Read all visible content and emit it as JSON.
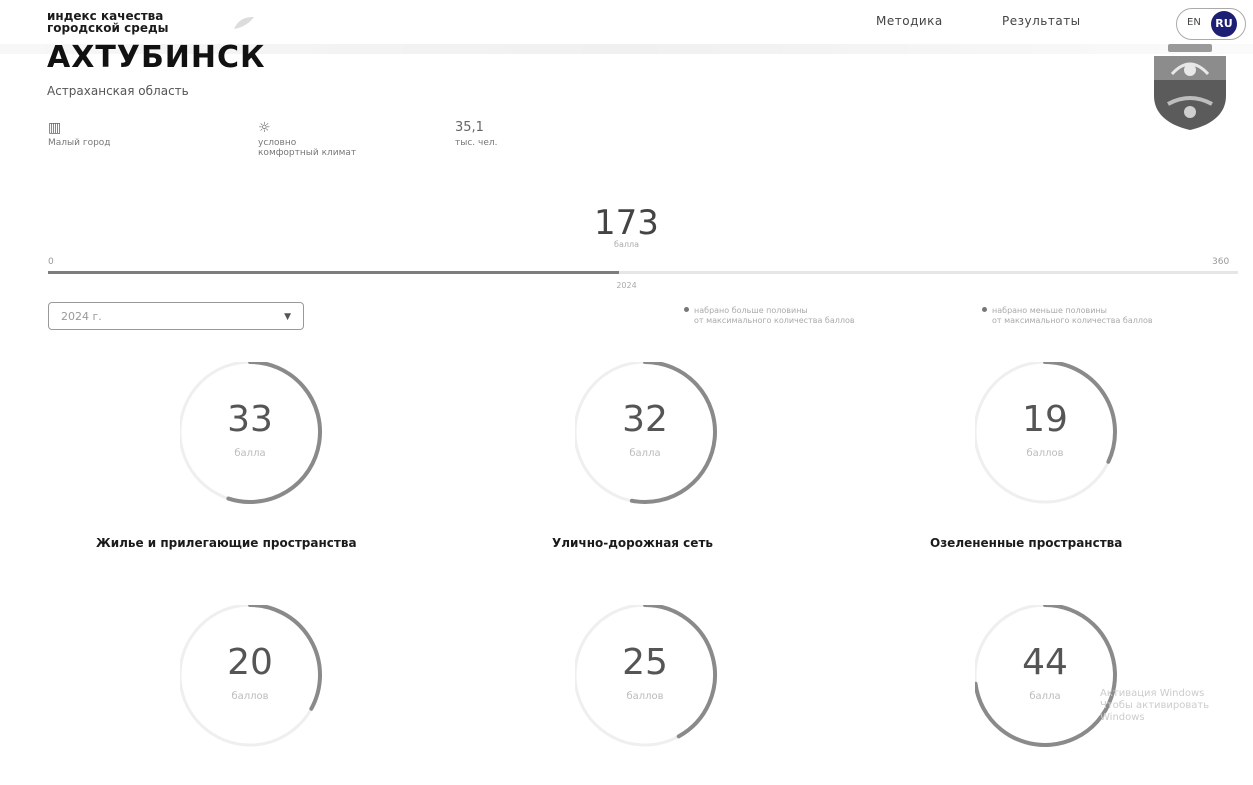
{
  "header": {
    "brand_line1": "индекс качества",
    "brand_line2": "городской среды",
    "nav": {
      "methodology": "Методика",
      "results": "Результаты"
    },
    "lang": {
      "en": "EN",
      "ru": "RU"
    }
  },
  "city": {
    "name": "АХТУБИНСК",
    "region": "Астраханская область",
    "features": {
      "city_type": "Малый город",
      "climate_line1": "условно",
      "climate_line2": "комфортный климат",
      "population_value": "35,1",
      "population_unit": "тыс. чел."
    }
  },
  "total": {
    "score": "173",
    "unit": "балла",
    "scale_min": "0",
    "scale_max": "360",
    "progress_fraction": 0.48,
    "year_marker": "2024"
  },
  "filter": {
    "year_value": "2024 г."
  },
  "legend": {
    "above_line1": "набрано больше половины",
    "above_line2": "от максимального количества баллов",
    "below_line1": "набрано меньше половины",
    "below_line2": "от максимального количества баллов"
  },
  "categories": [
    {
      "score": "33",
      "unit": "балла",
      "title": "Жилье и прилегающие пространства",
      "fraction": 0.55
    },
    {
      "score": "32",
      "unit": "балла",
      "title": "Улично-дорожная сеть",
      "fraction": 0.53
    },
    {
      "score": "19",
      "unit": "баллов",
      "title": "Озелененные пространства",
      "fraction": 0.32
    },
    {
      "score": "20",
      "unit": "баллов",
      "fraction": 0.33
    },
    {
      "score": "25",
      "unit": "баллов",
      "fraction": 0.42
    },
    {
      "score": "44",
      "unit": "балла",
      "fraction": 0.73
    }
  ],
  "colors": {
    "accent": "#1c1f73",
    "arc": "#8a8a8a",
    "arc_track": "#efefef",
    "progress": "#7d7d7d"
  },
  "watermark": {
    "line1": "Активация Windows",
    "line2": "Чтобы активировать Windows"
  }
}
